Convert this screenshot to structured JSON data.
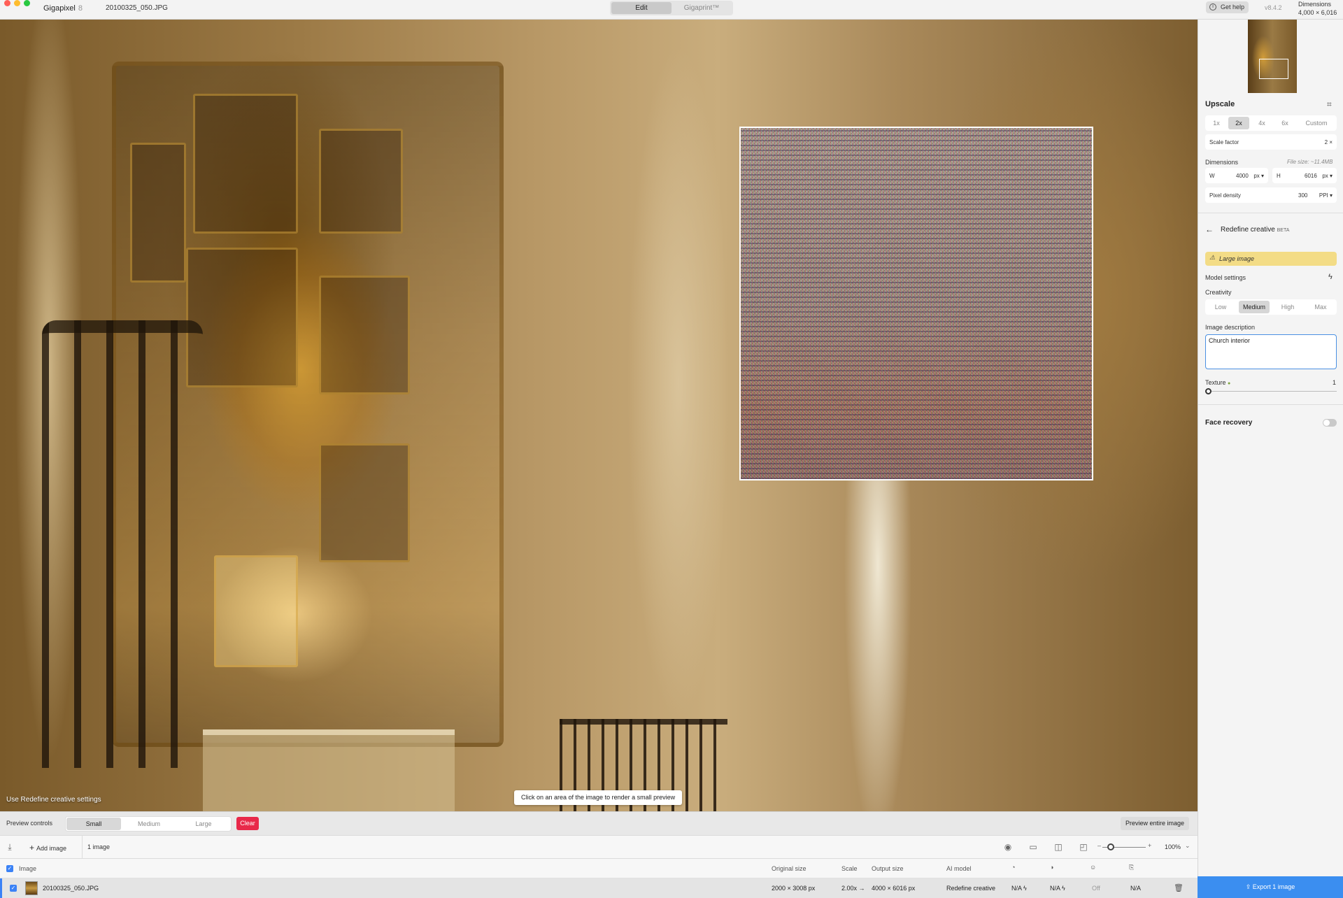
{
  "window": {
    "app_name": "Gigapixel",
    "app_version": "8",
    "file_name": "20100325_050.JPG",
    "traffic_colors": {
      "close": "#ff5f57",
      "minimize": "#febc2e",
      "zoom": "#28c840"
    }
  },
  "mode_tabs": [
    {
      "label": "Edit",
      "active": true
    },
    {
      "label": "Gigaprint™",
      "active": false
    }
  ],
  "header_right": {
    "help_label": "Get help",
    "version": "v8.4.2",
    "dimensions_label": "Dimensions",
    "dimensions_value": "4,000 × 6,016"
  },
  "preview": {
    "overlay_label": "Use Redefine creative settings",
    "hint": "Click on an area of the image to render a small preview"
  },
  "preview_controls": {
    "label": "Preview controls",
    "sizes": [
      {
        "label": "Small",
        "active": true
      },
      {
        "label": "Medium",
        "active": false
      },
      {
        "label": "Large",
        "active": false
      }
    ],
    "clear_label": "Clear",
    "preview_entire_label": "Preview entire image",
    "clear_color": "#e8294a"
  },
  "toolbar": {
    "add_image_label": "Add image",
    "image_count": "1 image",
    "zoom_level": "100%",
    "icons": [
      "sort-down-icon",
      "eye-icon",
      "single-view-icon",
      "split-view-icon",
      "side-by-side-icon"
    ]
  },
  "file_list": {
    "columns": {
      "image": "Image",
      "original_size": "Original size",
      "scale": "Scale",
      "output_size": "Output size",
      "ai_model": "AI model"
    },
    "rows": [
      {
        "name": "20100325_050.JPG",
        "original_size": "2000 × 3008 px",
        "scale": "2.00x →",
        "output_size": "4000 × 6016 px",
        "ai_model": "Redefine creative",
        "col_a": "N/A",
        "col_b": "N/A",
        "col_c": "Off",
        "col_d": "N/A"
      }
    ]
  },
  "upscale": {
    "title": "Upscale",
    "options": [
      {
        "label": "1x",
        "active": false
      },
      {
        "label": "2x",
        "active": true
      },
      {
        "label": "4x",
        "active": false
      },
      {
        "label": "6x",
        "active": false
      },
      {
        "label": "Custom",
        "active": false
      }
    ],
    "scale_factor_label": "Scale factor",
    "scale_factor_value": "2 ×",
    "dimensions_label": "Dimensions",
    "file_size": "File size: ~11.4MB",
    "width_label": "W",
    "width_value": "4000",
    "width_unit": "px ▾",
    "height_label": "H",
    "height_value": "6016",
    "height_unit": "px ▾",
    "pixel_density_label": "Pixel density",
    "pixel_density_value": "300",
    "pixel_density_unit": "PPI ▾"
  },
  "redefine": {
    "title": "Redefine creative",
    "badge": "BETA",
    "warning": "Large image",
    "warning_color": "#f3dc86",
    "model_settings_label": "Model settings",
    "creativity_label": "Creativity",
    "creativity_options": [
      {
        "label": "Low",
        "active": false
      },
      {
        "label": "Medium",
        "active": true
      },
      {
        "label": "High",
        "active": false
      },
      {
        "label": "Max",
        "active": false
      }
    ],
    "image_description_label": "Image description",
    "image_description_value": "Church interior",
    "texture_label": "Texture",
    "texture_value": "1",
    "face_recovery_label": "Face recovery",
    "face_recovery_on": false
  },
  "export": {
    "label": "Export 1 image",
    "color": "#3b8ef0"
  }
}
